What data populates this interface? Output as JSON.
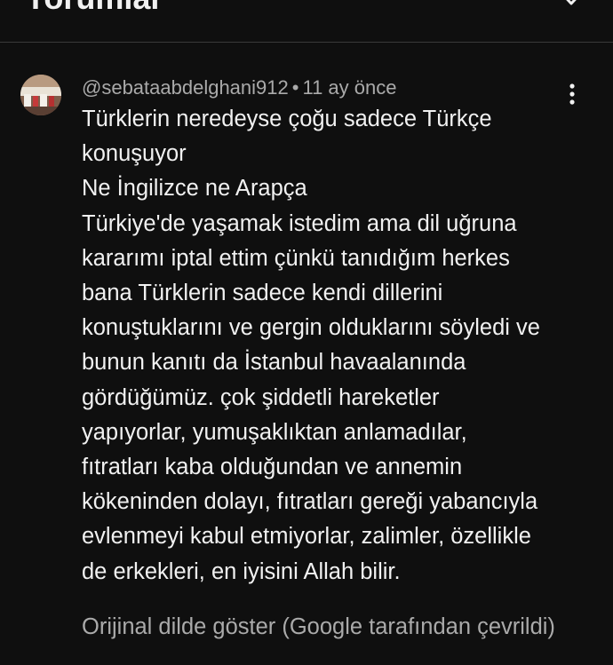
{
  "header": {
    "title": "Yorumlar",
    "close_icon": "close-icon"
  },
  "comment": {
    "author": "@sebataabdelghani912",
    "separator": "•",
    "time": "11 ay önce",
    "more_icon": "more-vert-icon",
    "lines": [
      "Türklerin neredeyse çoğu sadece Türkçe",
      "konuşuyor",
      "Ne İngilizce ne Arapça",
      "Türkiye'de yaşamak istedim ama dil uğruna",
      "kararımı iptal ettim çünkü tanıdığım herkes",
      "bana Türklerin sadece kendi dillerini",
      "konuştuklarını ve gergin olduklarını söyledi ve",
      "bunun kanıtı da İstanbul havaalanında",
      "gördüğümüz. çok şiddetli hareketler",
      "yapıyorlar, yumuşaklıktan anlamadılar,",
      "fıtratları kaba olduğundan ve annemin",
      "kökeninden dolayı, fıtratları gereği yabancıyla",
      "evlenmeyi kabul etmiyorlar, zalimler, özellikle",
      "de erkekleri, en iyisini Allah bilir."
    ],
    "translate_label": "Orijinal dilde göster (Google tarafından çevrildi)"
  },
  "colors": {
    "background": "#0f0f0f",
    "text_primary": "#f1f1f1",
    "text_secondary": "#aaaaaa",
    "divider": "#3a3a3a"
  }
}
